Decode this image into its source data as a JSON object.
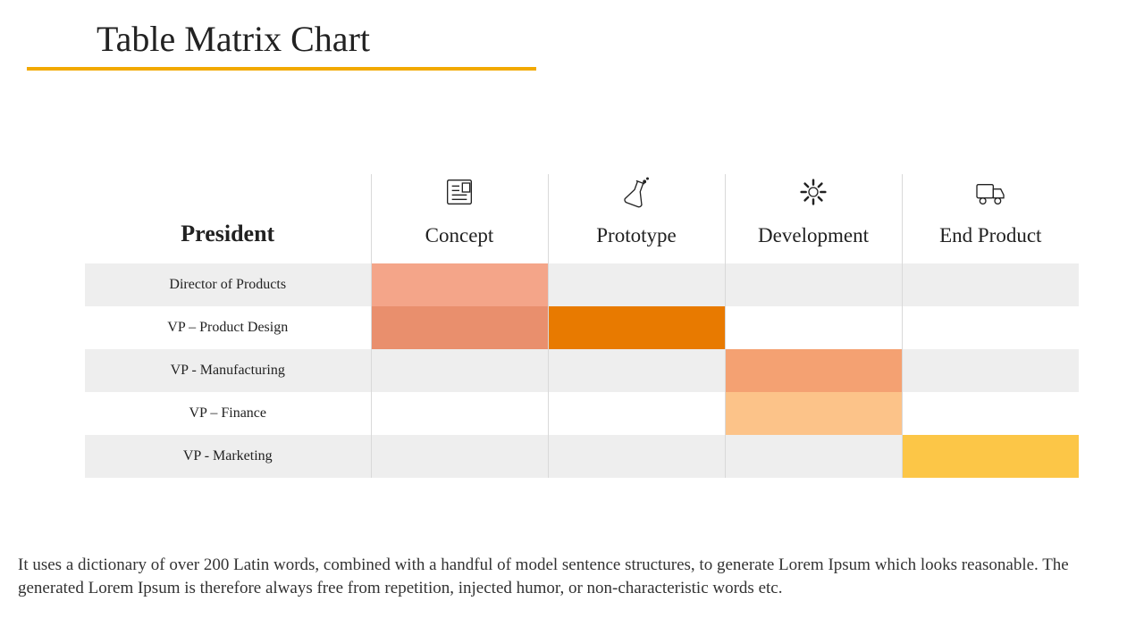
{
  "title": "Table Matrix Chart",
  "row_header_title": "President",
  "columns": [
    {
      "icon": "newspaper",
      "label": "Concept"
    },
    {
      "icon": "flask",
      "label": "Prototype"
    },
    {
      "icon": "gear",
      "label": "Development"
    },
    {
      "icon": "truck",
      "label": "End Product"
    }
  ],
  "rows": [
    {
      "label": "Director of Products"
    },
    {
      "label": "VP – Product Design"
    },
    {
      "label": "VP - Manufacturing"
    },
    {
      "label": "VP – Finance"
    },
    {
      "label": "VP - Marketing"
    }
  ],
  "chart_data": {
    "type": "heatmap",
    "title": "Table Matrix Chart",
    "x_categories": [
      "Concept",
      "Prototype",
      "Development",
      "End Product"
    ],
    "y_categories": [
      "Director of Products",
      "VP – Product Design",
      "VP - Manufacturing",
      "VP – Finance",
      "VP - Marketing"
    ],
    "cells": [
      {
        "row": "Director of Products",
        "col": "Concept",
        "color": "#f4a589"
      },
      {
        "row": "VP – Product Design",
        "col": "Concept",
        "color": "#e98f6d"
      },
      {
        "row": "VP – Product Design",
        "col": "Prototype",
        "color": "#e87a00"
      },
      {
        "row": "VP - Manufacturing",
        "col": "Development",
        "color": "#f4a172"
      },
      {
        "row": "VP – Finance",
        "col": "Development",
        "color": "#fcc389"
      },
      {
        "row": "VP - Marketing",
        "col": "End Product",
        "color": "#fcc647"
      }
    ]
  },
  "caption": "It uses a dictionary of over 200 Latin words, combined with a handful of model sentence structures, to generate Lorem Ipsum which looks reasonable. The generated Lorem Ipsum is therefore always free from repetition, injected humor, or non-characteristic words etc."
}
